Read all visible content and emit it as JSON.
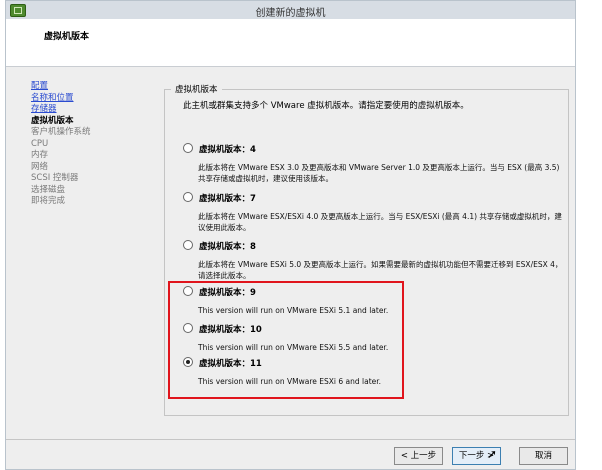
{
  "window": {
    "title": "创建新的虚拟机"
  },
  "header": {
    "title": "虚拟机版本"
  },
  "sidebar": {
    "items": [
      {
        "label": "配置",
        "state": "link"
      },
      {
        "label": "名称和位置",
        "state": "link"
      },
      {
        "label": "存储器",
        "state": "link"
      },
      {
        "label": "虚拟机版本",
        "state": "current"
      },
      {
        "label": "客户机操作系统",
        "state": "disabled"
      },
      {
        "label": "CPU",
        "state": "disabled"
      },
      {
        "label": "内存",
        "state": "disabled"
      },
      {
        "label": "网络",
        "state": "disabled"
      },
      {
        "label": "SCSI 控制器",
        "state": "disabled"
      },
      {
        "label": "选择磁盘",
        "state": "disabled"
      },
      {
        "label": "即将完成",
        "state": "disabled"
      }
    ]
  },
  "panel": {
    "title": "虚拟机版本",
    "description": "此主机或群集支持多个 VMware 虚拟机版本。请指定要使用的虚拟机版本。",
    "options": [
      {
        "label": "虚拟机版本：4",
        "checked": false,
        "description": "此版本将在 VMware ESX 3.0 及更高版本和 VMware Server 1.0 及更高版本上运行。当与 ESX (最高 3.5) 共享存储或虚拟机时，建议使用该版本。"
      },
      {
        "label": "虚拟机版本：7",
        "checked": false,
        "description": "此版本将在 VMware ESX/ESXi 4.0 及更高版本上运行。当与 ESX/ESXi (最高 4.1) 共享存储或虚拟机时，建议使用此版本。"
      },
      {
        "label": "虚拟机版本：8",
        "checked": false,
        "description": "此版本将在 VMware ESXi 5.0 及更高版本上运行。如果需要最新的虚拟机功能但不需要迁移到 ESX/ESX 4，请选择此版本。"
      },
      {
        "label": "虚拟机版本：9",
        "checked": false,
        "description": "This version will run on VMware ESXi 5.1 and later."
      },
      {
        "label": "虚拟机版本：10",
        "checked": false,
        "description": "This version will run on VMware ESXi 5.5 and later."
      },
      {
        "label": "虚拟机版本：11",
        "checked": true,
        "description": "This version will run on VMware ESXi 6 and later."
      }
    ]
  },
  "buttons": {
    "back": "< 上一步",
    "next": "下一步 >",
    "cancel": "取消"
  },
  "colors": {
    "highlight": "#e0141c",
    "link": "#2a4bd0"
  }
}
